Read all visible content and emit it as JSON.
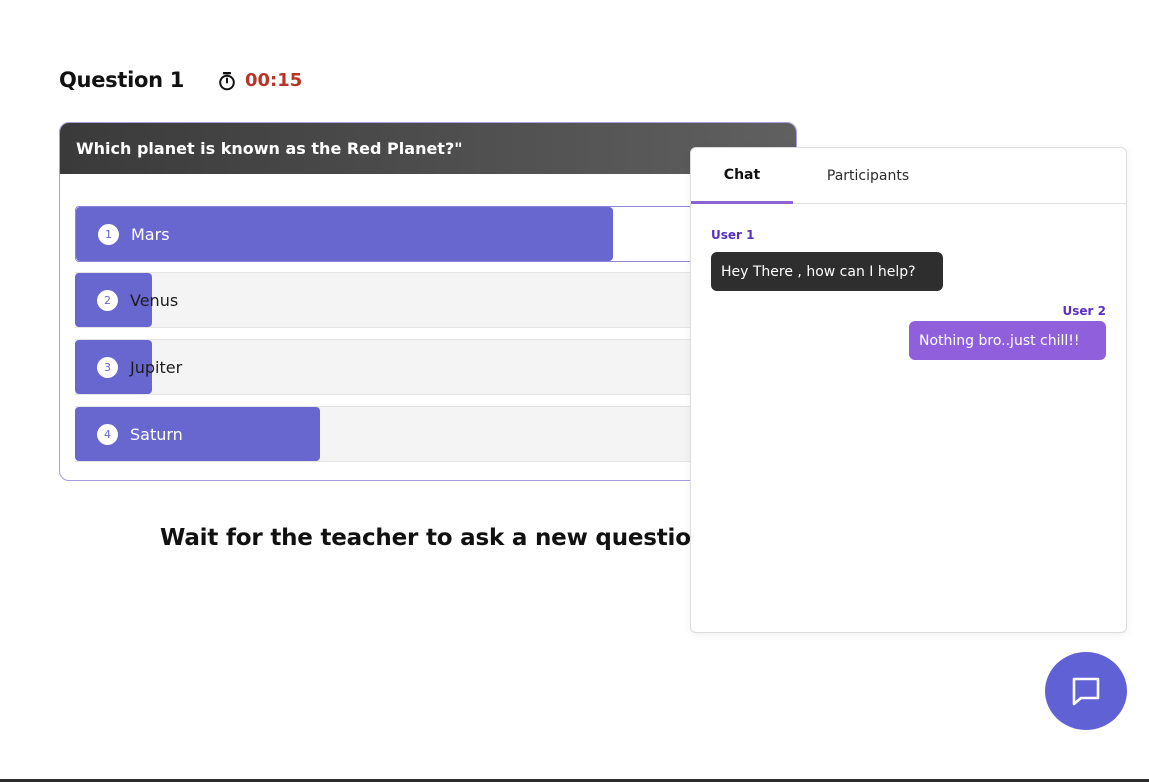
{
  "header": {
    "question_label": "Question 1",
    "timer": "00:15"
  },
  "quiz": {
    "question": "Which planet is known as the Red Planet?\"",
    "options": [
      {
        "num": "1",
        "label": "Mars",
        "vote_fraction": 0.77,
        "selected": true
      },
      {
        "num": "2",
        "label": "Venus",
        "vote_fraction": 0.11,
        "selected": false
      },
      {
        "num": "3",
        "label": "Jupiter",
        "vote_fraction": 0.11,
        "selected": false
      },
      {
        "num": "4",
        "label": "Saturn",
        "vote_fraction": 0.35,
        "selected": false
      }
    ]
  },
  "wait_message": "Wait for the teacher to ask a new question.",
  "chat": {
    "tabs": [
      {
        "label": "Chat",
        "active": true
      },
      {
        "label": "Participants",
        "active": false
      }
    ],
    "messages": [
      {
        "sender": "User 1",
        "text": "Hey There , how can I help?"
      },
      {
        "sender": "User 2",
        "text": "Nothing bro..just chill!!"
      }
    ]
  },
  "colors": {
    "accent": "#6866cf",
    "timer": "#b8352a",
    "own_message": "#9060dc",
    "other_message": "#2e2e2e"
  },
  "icons": {
    "timer": "stopwatch-icon",
    "chat_fab": "chat-bubble-icon"
  }
}
